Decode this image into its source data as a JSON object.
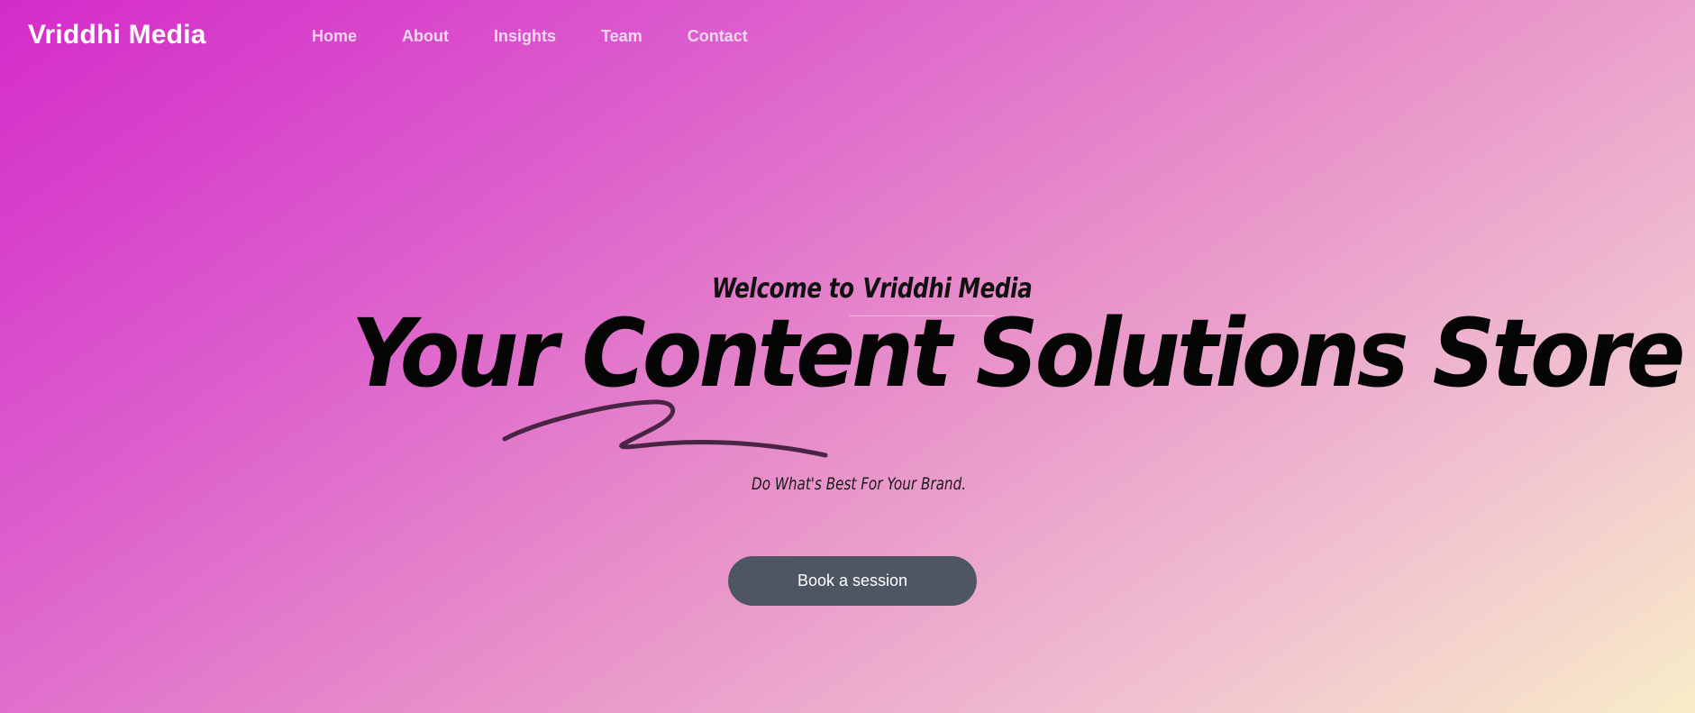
{
  "header": {
    "brand": "Vriddhi Media",
    "nav": [
      {
        "label": "Home"
      },
      {
        "label": "About"
      },
      {
        "label": "Insights"
      },
      {
        "label": "Team"
      },
      {
        "label": "Contact"
      }
    ]
  },
  "hero": {
    "welcome_prefix": "Welcome to",
    "welcome_brand": "Vriddhi Media",
    "headline": "Your Content Solutions Store",
    "tagline": "Do What's Best For Your Brand.",
    "cta_label": "Book a session"
  },
  "colors": {
    "gradient_start": "#d42bc9",
    "gradient_end": "#f8ecc8",
    "button_bg": "#4f5663",
    "swoosh": "#4a2445"
  }
}
